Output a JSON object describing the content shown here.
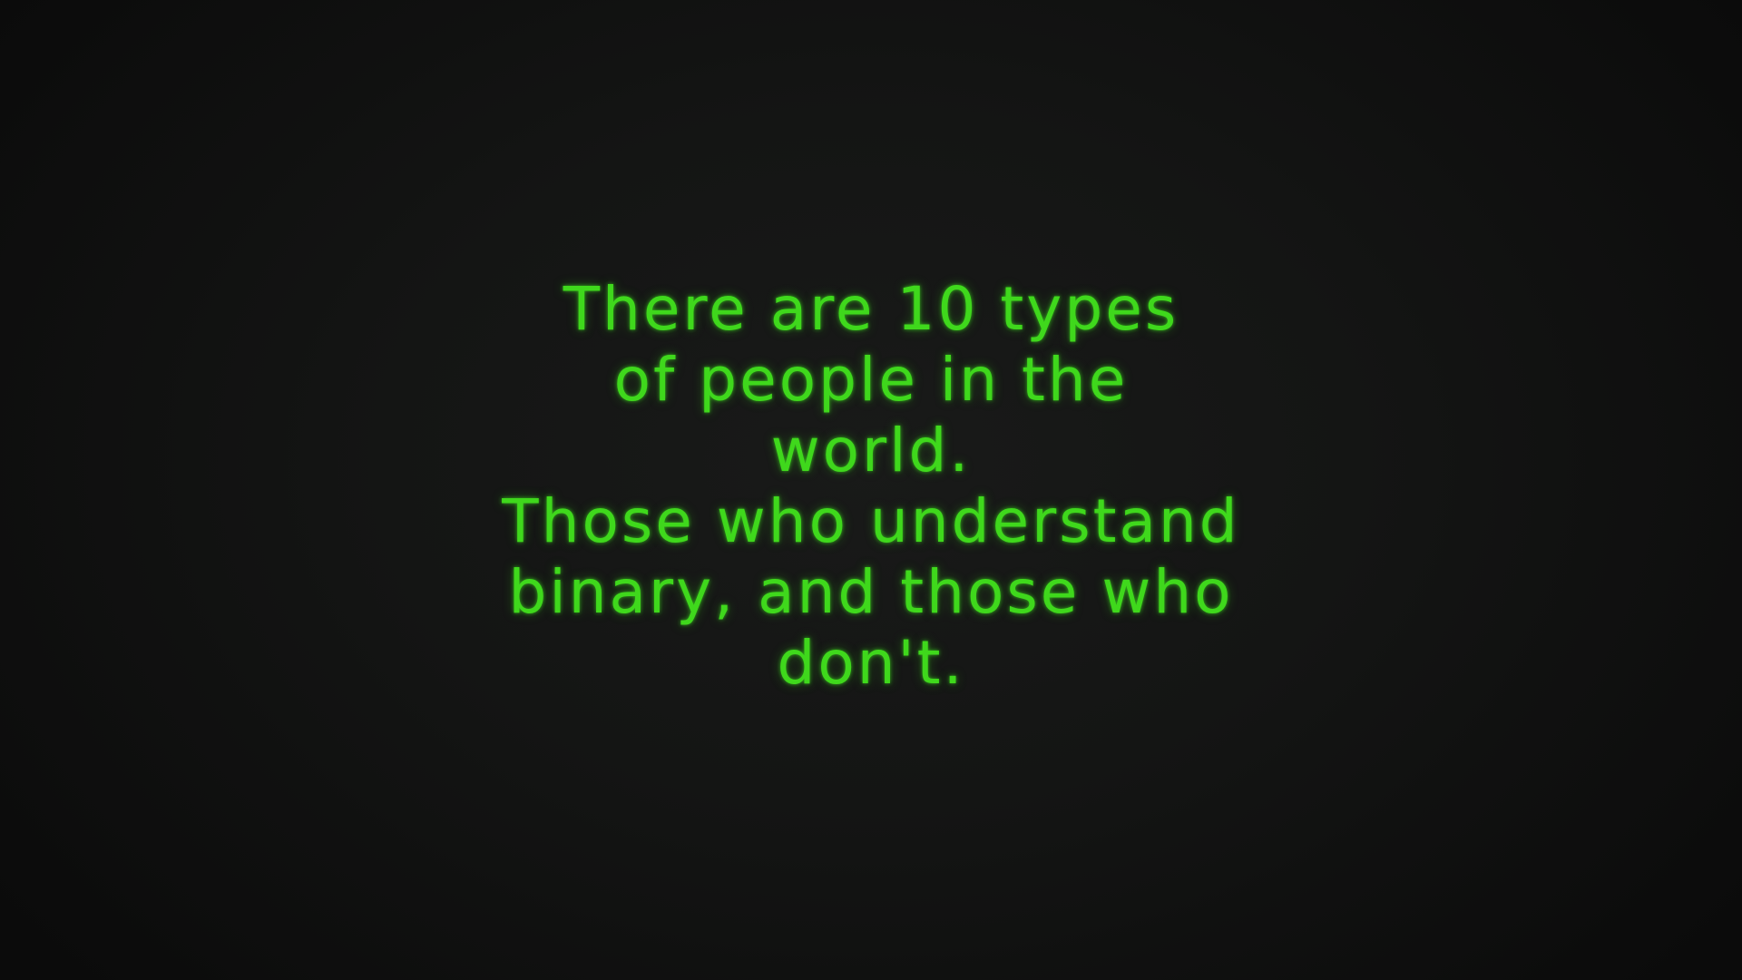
{
  "screen": {
    "background_color": "#141514",
    "text_color": "#3fd81c"
  },
  "quote": {
    "lines": [
      "There are 10 types",
      "of people in the",
      "world.",
      "Those who understand",
      "binary, and those who",
      "don't."
    ]
  }
}
